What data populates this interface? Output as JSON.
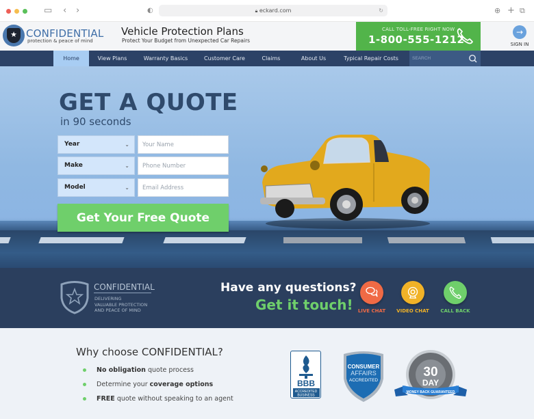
{
  "browser": {
    "url": "eckard.com",
    "window_controls": [
      "close",
      "minimize",
      "zoom"
    ],
    "colors": {
      "close": "#ee5f57",
      "minimize": "#f5bd4f",
      "zoom": "#5ac05a"
    }
  },
  "header": {
    "logo_title": "CONFIDENTIAL",
    "logo_subtitle": "protection & peace of mind",
    "tagline_title": "Vehicle Protection Plans",
    "tagline_subtitle": "Protect Your Budget from Unexpected Car Repairs",
    "call_label": "CALL TOLL-FREE RIGHT NOW",
    "phone": "1-800-555-1212",
    "sign_in": "SIGN IN"
  },
  "nav": {
    "items": [
      {
        "label": "Home",
        "active": true
      },
      {
        "label": "View Plans",
        "active": false
      },
      {
        "label": "Warranty Basics",
        "active": false
      },
      {
        "label": "Customer Care",
        "active": false
      },
      {
        "label": "Claims",
        "active": false
      },
      {
        "label": "About Us",
        "active": false
      },
      {
        "label": "Typical Repair Costs",
        "active": false
      }
    ],
    "search_placeholder": "SEARCH"
  },
  "hero": {
    "title": "GET A QUOTE",
    "subtitle": "in 90 seconds",
    "selects": [
      {
        "label": "Year"
      },
      {
        "label": "Make"
      },
      {
        "label": "Model"
      }
    ],
    "inputs": [
      {
        "placeholder": "Your Name",
        "value": ""
      },
      {
        "placeholder": "Phone Number",
        "value": ""
      },
      {
        "placeholder": "Email Address",
        "value": ""
      }
    ],
    "cta": "Get Your Free Quote"
  },
  "contact_band": {
    "brand": "CONFIDENTIAL",
    "brand_lines": [
      "DELIVERING",
      "VALUABLE PROTECTION",
      "AND PEACE OF MIND"
    ],
    "question": "Have any questions?",
    "cta": "Get it touch!",
    "options": [
      {
        "label": "LIVE CHAT",
        "icon": "chat-bubbles-icon",
        "color": "#f06a45"
      },
      {
        "label": "VIDEO CHAT",
        "icon": "webcam-icon",
        "color": "#f1b227"
      },
      {
        "label": "CALL BACK",
        "icon": "phone-icon",
        "color": "#6fcf6b"
      }
    ]
  },
  "why": {
    "title": "Why choose CONFIDENTIAL?",
    "points": [
      {
        "bold": "No obligation",
        "rest": " quote process",
        "bold_first": true
      },
      {
        "bold": "coverage options",
        "rest": "Determine your ",
        "bold_first": false
      },
      {
        "bold": "FREE",
        "rest": " quote without speaking to an agent",
        "bold_first": true
      }
    ],
    "badges": {
      "bbb": {
        "main": "BBB",
        "sub1": "ACCREDITED",
        "sub2": "BUSINESS"
      },
      "consumer_affairs": {
        "line1": "CONSUMER",
        "line2": "AFFAIRS",
        "line3": "ACCREDITED"
      },
      "money_back": {
        "number": "30",
        "unit": "DAY",
        "ring": "MONEY BACK GUARANTEED",
        "ribbon": "MONEY BACK GUARANTEED"
      }
    }
  }
}
